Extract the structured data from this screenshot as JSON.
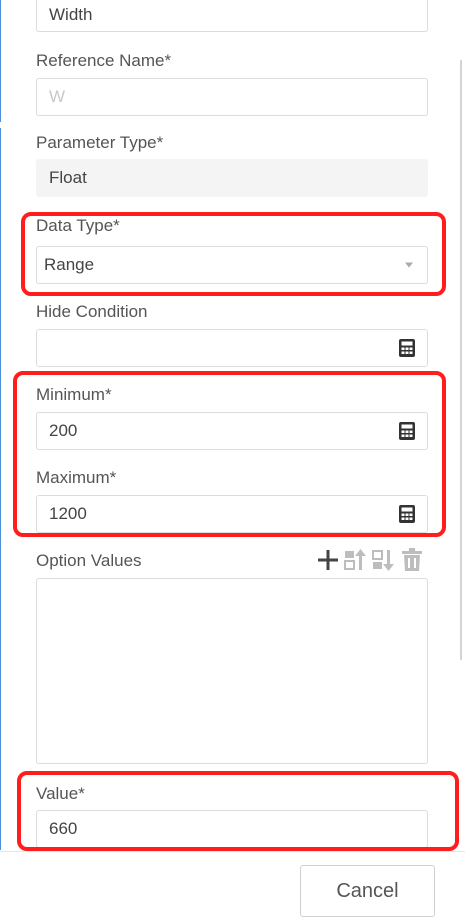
{
  "form": {
    "width_field": {
      "value": "Width"
    },
    "reference_name": {
      "label": "Reference Name*",
      "value": "W"
    },
    "parameter_type": {
      "label": "Parameter Type*",
      "value": "Float"
    },
    "data_type": {
      "label": "Data Type*",
      "value": "Range"
    },
    "hide_condition": {
      "label": "Hide Condition",
      "value": ""
    },
    "minimum": {
      "label": "Minimum*",
      "value": "200"
    },
    "maximum": {
      "label": "Maximum*",
      "value": "1200"
    },
    "option_values": {
      "label": "Option Values",
      "toolbar": [
        "plus-icon",
        "move-up-icon",
        "move-down-icon",
        "trash-icon"
      ]
    },
    "value": {
      "label": "Value*",
      "value": "660"
    }
  },
  "footer": {
    "cancel_label": "Cancel"
  },
  "colors": {
    "highlight": "#ff1d1d",
    "label": "#555555",
    "field_border": "#dcdcdc",
    "readonly_bg": "#f4f4f4"
  }
}
